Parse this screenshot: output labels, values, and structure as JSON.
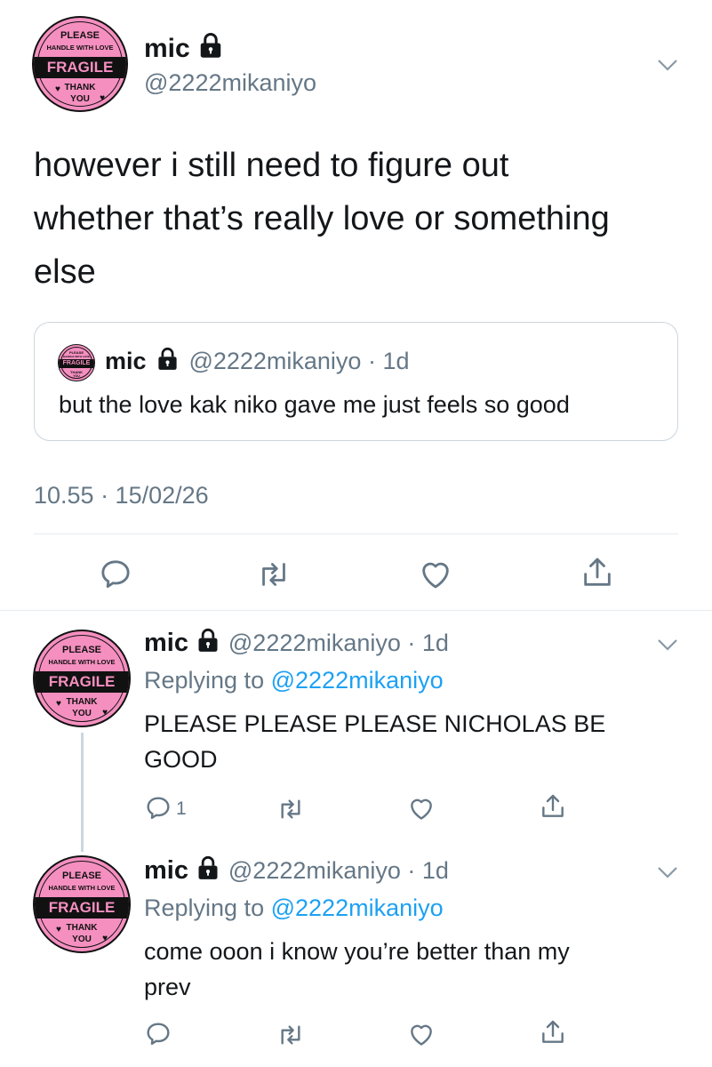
{
  "main_tweet": {
    "name": "mic",
    "handle": "@2222mikaniyo",
    "text_line1": "however i still need to figure out",
    "text_line2": "whether that’s really love or something",
    "text_line3": "else",
    "timestamp": "10.55 · 15/02/26"
  },
  "quote": {
    "name": "mic",
    "handle_time": "@2222mikaniyo · 1d",
    "text": "but the love kak niko gave me just feels so good"
  },
  "avatar": {
    "line1": "PLEASE",
    "line2": "HANDLE WITH LOVE",
    "band": "FRAGILE",
    "line3": "THANK",
    "line4": "YOU"
  },
  "replies": [
    {
      "name": "mic",
      "handle_time": "@2222mikaniyo · 1d",
      "replying_prefix": "Replying to",
      "replying_to": "@2222mikaniyo",
      "text_line1": "PLEASE PLEASE PLEASE NICHOLAS BE",
      "text_line2": "GOOD",
      "reply_count": "1"
    },
    {
      "name": "mic",
      "handle_time": "@2222mikaniyo · 1d",
      "replying_prefix": "Replying to",
      "replying_to": "@2222mikaniyo",
      "text_line1": "come ooon i know you’re better than my",
      "text_line2": "prev",
      "reply_count": ""
    }
  ],
  "icons": [
    "chevron-down-icon",
    "lock-icon",
    "reply-icon",
    "retweet-icon",
    "like-icon",
    "share-icon"
  ],
  "colors": {
    "accent": "#1da1f2",
    "secondary_text": "#657786",
    "sticker_pink": "#f58fc0",
    "border": "#e6ecf0"
  }
}
